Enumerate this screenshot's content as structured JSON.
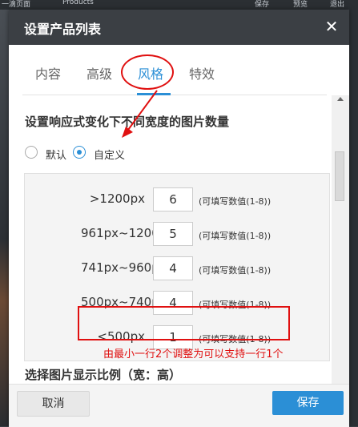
{
  "background": {
    "top_items": [
      "一滴页面",
      "Products",
      "保存",
      "预览",
      "退出"
    ]
  },
  "dialog": {
    "title": "设置产品列表",
    "close_label": "✕"
  },
  "tabs": [
    {
      "label": "内容",
      "active": false
    },
    {
      "label": "高级",
      "active": false
    },
    {
      "label": "风格",
      "active": true
    },
    {
      "label": "特效",
      "active": false
    }
  ],
  "section": {
    "title": "设置响应式变化下不同宽度的图片数量",
    "radio_default": "默认",
    "radio_custom": "自定义",
    "selected": "自定义"
  },
  "rows": [
    {
      "label": ">1200px",
      "value": "6",
      "hint": "(可填写数值(1-8))"
    },
    {
      "label": "961px~1200px",
      "value": "5",
      "hint": "(可填写数值(1-8))"
    },
    {
      "label": "741px~960px",
      "value": "4",
      "hint": "(可填写数值(1-8))"
    },
    {
      "label": "500px~740px",
      "value": "4",
      "hint": "(可填写数值(1-8))"
    },
    {
      "label": "<500px",
      "value": "1",
      "hint": "(可填写数值(1-8))"
    }
  ],
  "next_section_title": "选择图片显示比例（宽：高）",
  "footer": {
    "cancel": "取消",
    "save": "保存"
  },
  "annotation": {
    "text": "由最小一行2个调整为可以支持一行1个",
    "color": "#e01010"
  },
  "colors": {
    "accent": "#2b8fd6",
    "header": "#3b3f44"
  }
}
